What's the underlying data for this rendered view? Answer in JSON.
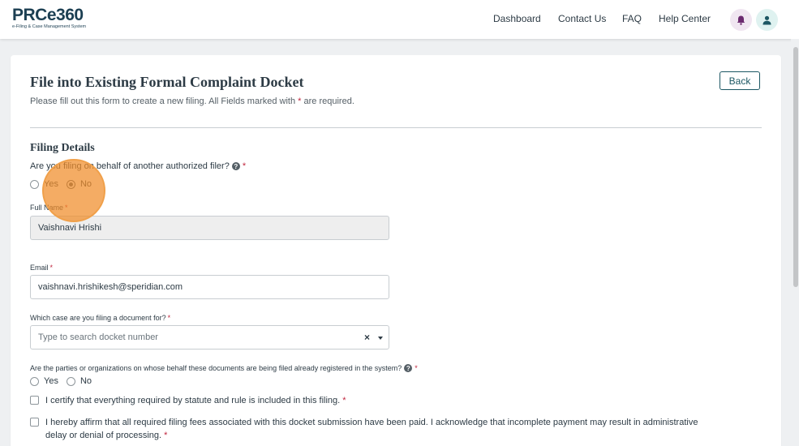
{
  "header": {
    "logo_main": "PRCe360",
    "logo_sub": "e-Filing & Case Management System",
    "nav": [
      "Dashboard",
      "Contact Us",
      "FAQ",
      "Help Center"
    ]
  },
  "page": {
    "title": "File into Existing Formal Complaint Docket",
    "subtitle_before": "Please fill out this form to create a new filing. All Fields marked with",
    "subtitle_after": "are required.",
    "back_label": "Back",
    "required_marker": "*"
  },
  "filing_details": {
    "section_title": "Filing Details",
    "behalf_question": "Are you filing on behalf of another authorized filer?",
    "behalf_options": [
      "Yes",
      "No"
    ],
    "behalf_selected": "No",
    "full_name_label": "Full Name",
    "full_name_value": "Vaishnavi Hrishi",
    "email_label": "Email",
    "email_value": "vaishnavi.hrishikesh@speridian.com",
    "case_label": "Which case are you filing a document for?",
    "case_placeholder": "Type to search docket number",
    "clear_glyph": "×",
    "parties_question": "Are the parties or organizations on whose behalf these documents are being filed already registered in the system?",
    "parties_options": [
      "Yes",
      "No"
    ],
    "certify_text": "I certify that everything required by statute and rule is included in this filing.",
    "affirm_text_line1": "I hereby affirm that all required filing fees associated with this docket submission have been paid. I acknowledge that incomplete payment may result in administrative",
    "affirm_text_line2": "delay or denial of processing."
  },
  "colors": {
    "primary": "#1c5763",
    "required": "#c0263e",
    "bell_bg": "#f0e6f1",
    "user_bg": "#dff2f0",
    "click_indicator": "#f08c28"
  },
  "icons": {
    "bell": "bell-icon",
    "user": "user-icon",
    "help": "question-circle-icon",
    "caret": "chevron-down-icon",
    "clear": "close-icon"
  }
}
